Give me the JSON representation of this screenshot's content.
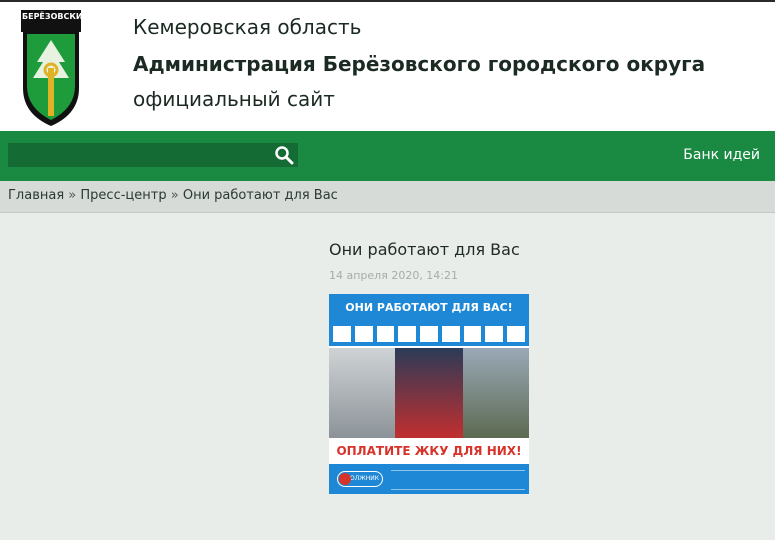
{
  "header": {
    "crest_label": "БЕРЁЗОВСКИЙ",
    "region": "Кемеровская область",
    "admin": "Администрация Берёзовского городского округа",
    "site": "официальный сайт"
  },
  "nav": {
    "search_placeholder": "",
    "ideas_label": "Банк идей"
  },
  "breadcrumb": {
    "items": [
      "Главная",
      "Пресс-центр",
      "Они работают для Вас"
    ],
    "separator": "»"
  },
  "article": {
    "title": "Они работают для Вас",
    "date": "14 апреля 2020, 14:21",
    "poster": {
      "top_text": "ОНИ РАБОТАЮТ ДЛЯ ВАС!",
      "middle_text": "ОПЛАТИТЕ ЖКУ ДЛЯ НИХ!",
      "badge_text": "ДОЛЖНИК"
    }
  },
  "colors": {
    "nav_green": "#1a8a42",
    "poster_blue": "#1e88d7",
    "poster_red": "#d7332b"
  }
}
